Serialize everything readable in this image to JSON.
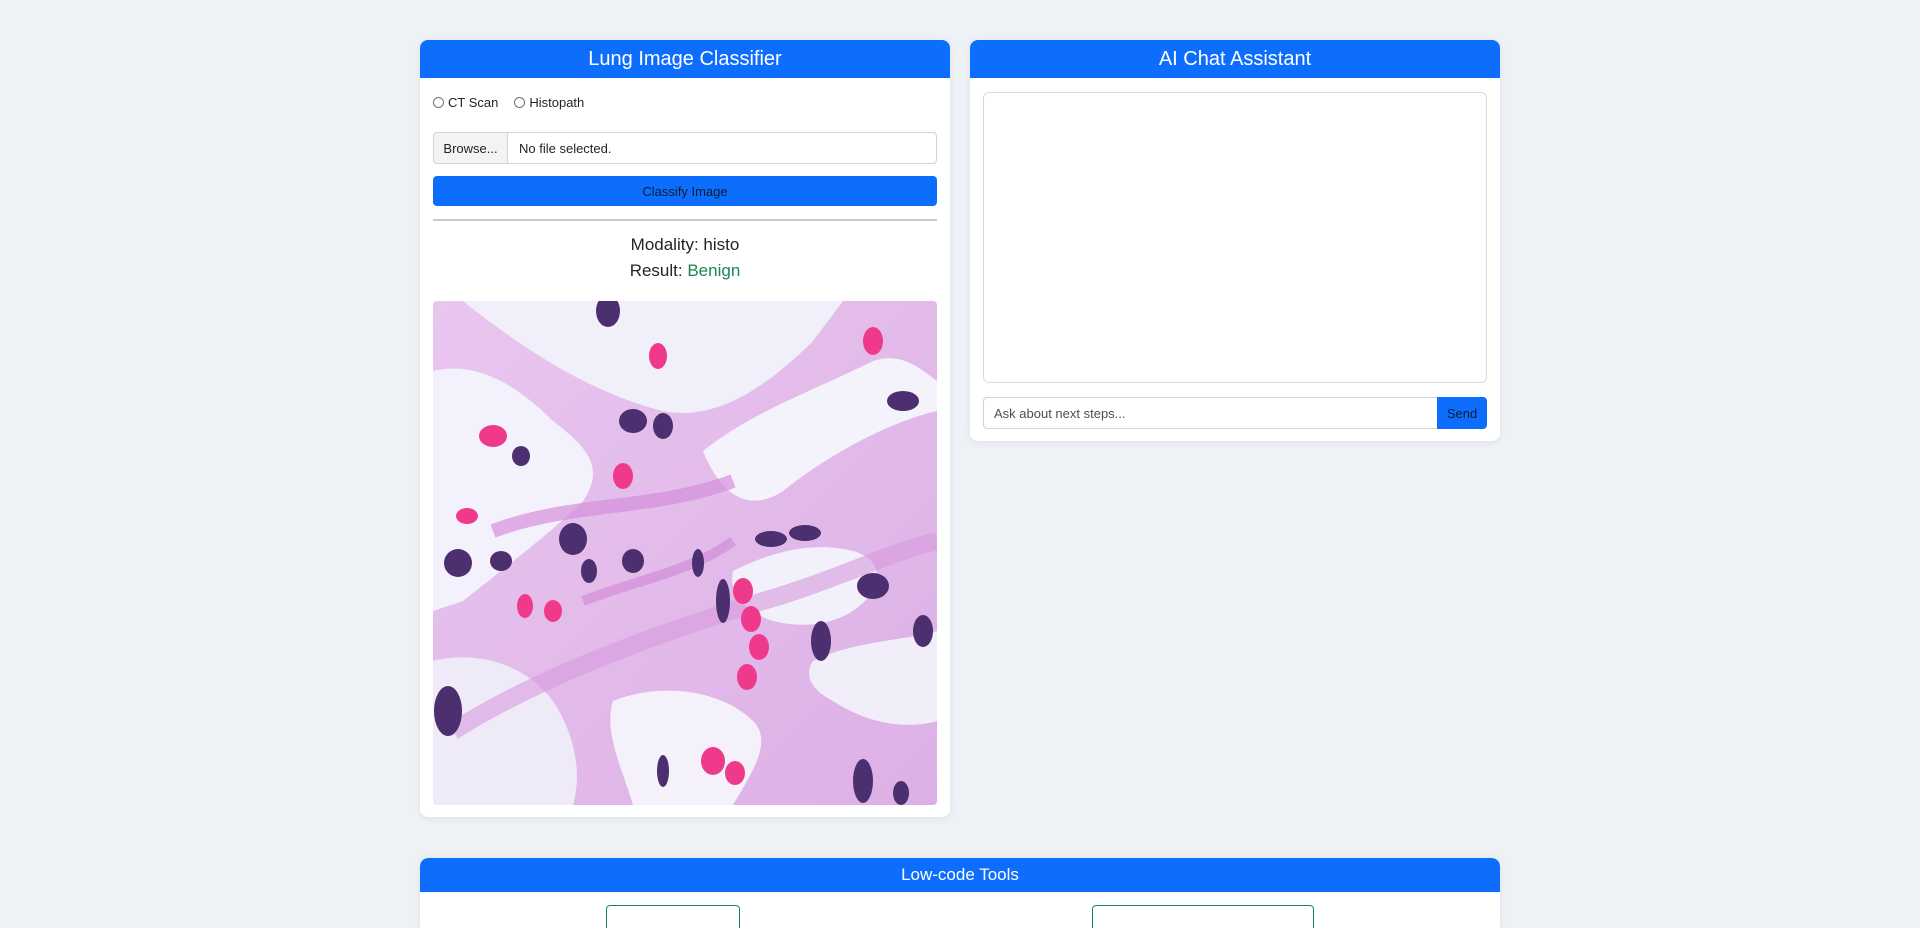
{
  "classifier": {
    "title": "Lung Image Classifier",
    "modality_options": [
      "CT Scan",
      "Histopath"
    ],
    "file": {
      "browse_label": "Browse...",
      "status": "No file selected."
    },
    "classify_label": "Classify Image",
    "modality_label": "Modality: histo",
    "result_label": "Result: ",
    "result_value": "Benign",
    "result_color": "#198754",
    "image": "histopathology-image"
  },
  "chat": {
    "title": "AI Chat Assistant",
    "input_placeholder": "Ask about next steps...",
    "send_label": "Send"
  },
  "lowcode": {
    "title": "Low-code Tools"
  },
  "colors": {
    "primary": "#0d6efd",
    "background": "#eef2f7",
    "success": "#198754"
  }
}
